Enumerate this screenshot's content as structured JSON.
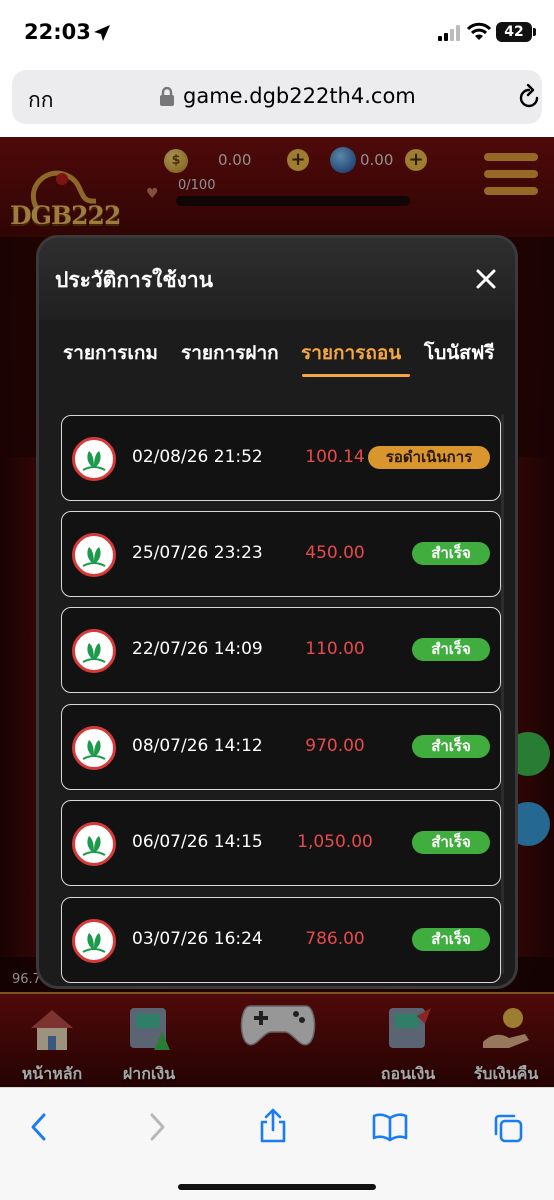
{
  "status_bar": {
    "time": "22:03",
    "battery": "42"
  },
  "browser": {
    "text_size_label": "กก",
    "url": "game.dgb222th4.com"
  },
  "game": {
    "logo_text": "DGB222",
    "coin_balance": "0.00",
    "gem_balance": "0.00",
    "exp_text": "0/100",
    "side_value": "96.7"
  },
  "bottom_nav": {
    "items": [
      {
        "label": "หน้าหลัก",
        "icon": "house-icon"
      },
      {
        "label": "ฝากเงิน",
        "icon": "deposit-atm-icon"
      },
      {
        "label": "ถอนเงิน",
        "icon": "withdraw-atm-icon"
      },
      {
        "label": "รับเงินคืน",
        "icon": "cashback-icon"
      }
    ]
  },
  "modal": {
    "title": "ประวัติการใช้งาน",
    "tabs": [
      {
        "label": "รายการเกม",
        "active": false
      },
      {
        "label": "รายการฝาก",
        "active": false
      },
      {
        "label": "รายการถอน",
        "active": true
      },
      {
        "label": "โบนัสฟรี",
        "active": false
      }
    ],
    "rows": [
      {
        "date": "02/08/26 21:52",
        "amount": "100.14",
        "status": "รอดำเนินการ",
        "status_type": "pending"
      },
      {
        "date": "25/07/26 23:23",
        "amount": "450.00",
        "status": "สำเร็จ",
        "status_type": "success"
      },
      {
        "date": "22/07/26 14:09",
        "amount": "110.00",
        "status": "สำเร็จ",
        "status_type": "success"
      },
      {
        "date": "08/07/26 14:12",
        "amount": "970.00",
        "status": "สำเร็จ",
        "status_type": "success"
      },
      {
        "date": "06/07/26 14:15",
        "amount": "1,050.00",
        "status": "สำเร็จ",
        "status_type": "success"
      },
      {
        "date": "03/07/26 16:24",
        "amount": "786.00",
        "status": "สำเร็จ",
        "status_type": "success"
      }
    ]
  },
  "colors": {
    "accent": "#f5a742",
    "amount_red": "#e64a4a",
    "success_green": "#3fae3f",
    "pending_orange": "#d9952e"
  }
}
